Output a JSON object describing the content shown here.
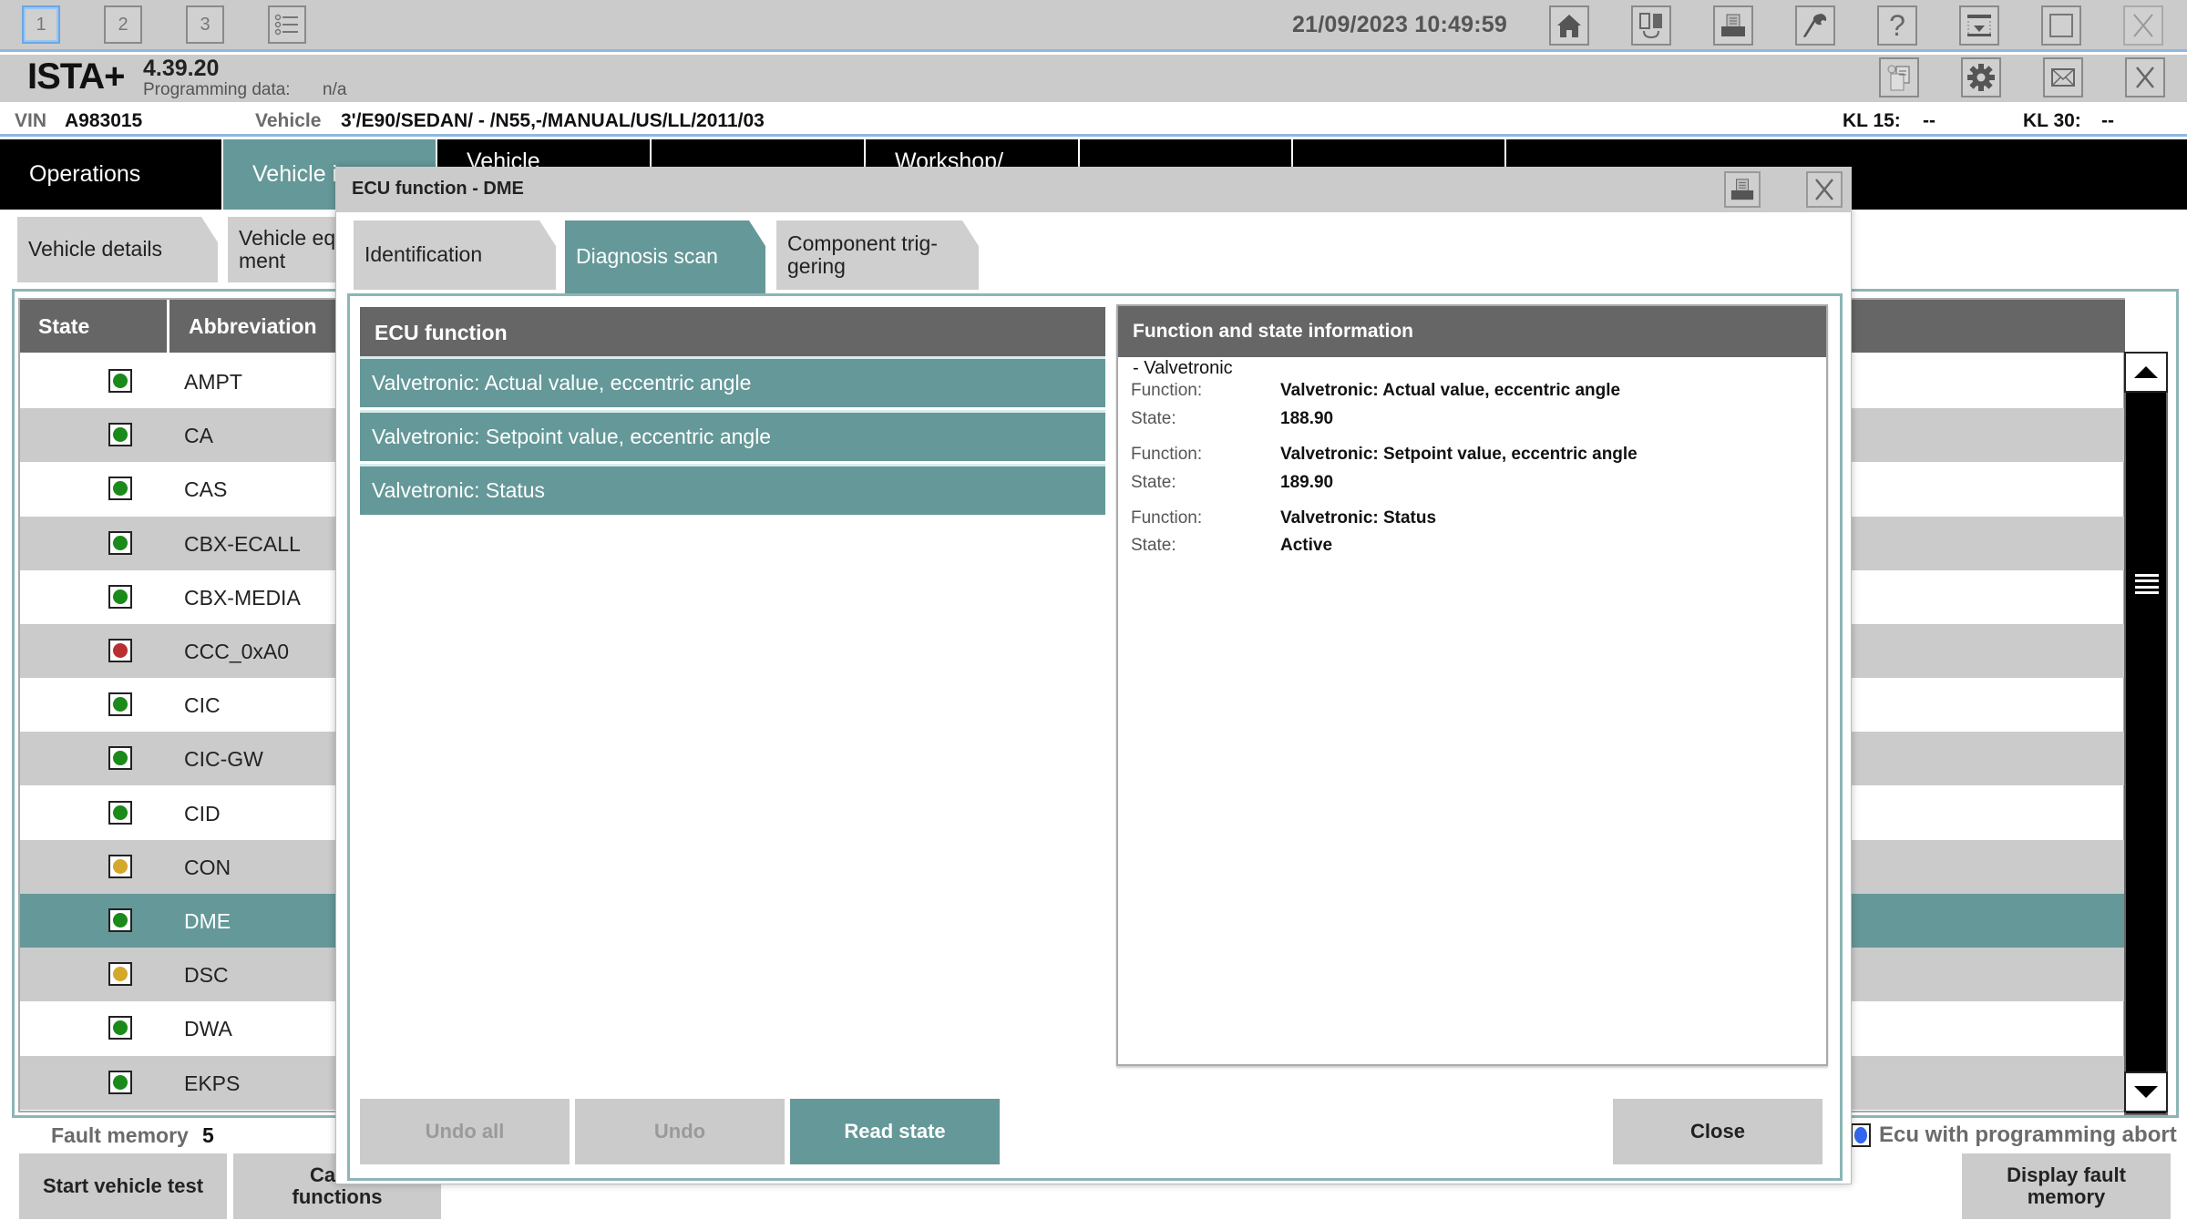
{
  "toolbar": {
    "session_tabs": [
      "1",
      "2",
      "3"
    ],
    "active_session": "1",
    "datetime": "21/09/2023 10:49:59",
    "icons": [
      "list-icon",
      "home-icon",
      "swap-icon",
      "print-icon",
      "wrench-icon",
      "help-icon",
      "minimize-icon",
      "maximize-icon",
      "close-icon"
    ]
  },
  "app": {
    "name": "ISTA+",
    "version": "4.39.20",
    "programming_data_label": "Programming data:",
    "programming_data_value": "n/a",
    "icons": [
      "documents-icon",
      "settings-icon",
      "mail-icon",
      "close-icon"
    ]
  },
  "vehicle_bar": {
    "vin_label": "VIN",
    "vin_value": "A983015",
    "vehicle_label": "Vehicle",
    "vehicle_value": "3'/E90/SEDAN/ - /N55,-/MANUAL/US/LL/2011/03",
    "kl15_label": "KL 15:",
    "kl15_value": "--",
    "kl30_label": "KL 30:",
    "kl30_value": "--"
  },
  "nav": {
    "tabs": [
      {
        "label": "Operations",
        "active": false
      },
      {
        "label": "Vehicle in",
        "active": true
      },
      {
        "label": "Vehicle",
        "active": false
      },
      {
        "label": "",
        "active": false
      },
      {
        "label": "Workshop/",
        "active": false
      },
      {
        "label": "",
        "active": false
      },
      {
        "label": "",
        "active": false
      }
    ]
  },
  "subtabs": [
    {
      "label": "Vehicle details"
    },
    {
      "label": "Vehicle eq\nment"
    }
  ],
  "ecu_table": {
    "columns": [
      "State",
      "Abbreviation"
    ],
    "rows": [
      {
        "state": "green",
        "abbr": "AMPT"
      },
      {
        "state": "green",
        "abbr": "CA"
      },
      {
        "state": "green",
        "abbr": "CAS"
      },
      {
        "state": "green",
        "abbr": "CBX-ECALL"
      },
      {
        "state": "green",
        "abbr": "CBX-MEDIA"
      },
      {
        "state": "red",
        "abbr": "CCC_0xA0"
      },
      {
        "state": "green",
        "abbr": "CIC"
      },
      {
        "state": "green",
        "abbr": "CIC-GW"
      },
      {
        "state": "green",
        "abbr": "CID"
      },
      {
        "state": "yellow",
        "abbr": "CON"
      },
      {
        "state": "green",
        "abbr": "DME",
        "selected": true
      },
      {
        "state": "yellow",
        "abbr": "DSC"
      },
      {
        "state": "green",
        "abbr": "DWA"
      },
      {
        "state": "green",
        "abbr": "EKPS"
      }
    ],
    "state_colors": {
      "green": "#1a8a1a",
      "red": "#b83030",
      "yellow": "#d4a82a"
    }
  },
  "footer": {
    "fault_memory_label": "Fault memory",
    "fault_memory_count": "5",
    "start_vehicle_test": "Start vehicle test",
    "call_functions": "Call u\nfunctions",
    "ecu_prog_abort_label": "Ecu with programming abort",
    "display_fault_memory": "Display fault\nmemory"
  },
  "dialog": {
    "title": "ECU function - DME",
    "tabs": [
      {
        "label": "Identification",
        "active": false
      },
      {
        "label": "Diagnosis scan",
        "active": true
      },
      {
        "label": "Component trig-\ngering",
        "active": false
      }
    ],
    "function_list": {
      "header": "ECU function",
      "items": [
        "Valvetronic: Actual value, eccentric angle",
        "Valvetronic: Setpoint value, eccentric angle",
        "Valvetronic: Status"
      ]
    },
    "info": {
      "header": "Function and state information",
      "group": "- Valvetronic",
      "function_label": "Function:",
      "state_label": "State:",
      "entries": [
        {
          "function": "Valvetronic: Actual value, eccentric angle",
          "state": "188.90"
        },
        {
          "function": "Valvetronic: Setpoint value, eccentric angle",
          "state": "189.90"
        },
        {
          "function": "Valvetronic: Status",
          "state": "Active"
        }
      ]
    },
    "buttons": {
      "undo_all": "Undo all",
      "undo": "Undo",
      "read_state": "Read state",
      "close": "Close"
    }
  },
  "colors": {
    "accent_teal": "#659898",
    "header_gray": "#666666",
    "toolbar_gray": "#cbcbcb",
    "focus_blue": "#8fb8e0"
  }
}
